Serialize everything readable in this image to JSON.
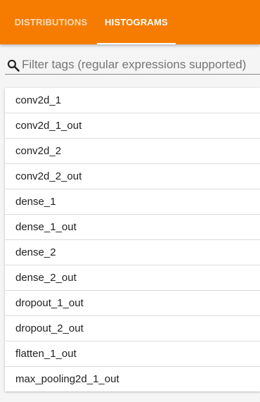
{
  "tabs": [
    {
      "label": "DISTRIBUTIONS",
      "active": false
    },
    {
      "label": "HISTOGRAMS",
      "active": true
    }
  ],
  "filter": {
    "placeholder": "Filter tags (regular expressions supported)",
    "value": "",
    "icon": "search-icon"
  },
  "tags": [
    "conv2d_1",
    "conv2d_1_out",
    "conv2d_2",
    "conv2d_2_out",
    "dense_1",
    "dense_1_out",
    "dense_2",
    "dense_2_out",
    "dropout_1_out",
    "dropout_2_out",
    "flatten_1_out",
    "max_pooling2d_1_out"
  ],
  "colors": {
    "header": "#f57c00",
    "active_tab": "#ffffff",
    "inactive_tab": "rgba(255,255,255,0.72)"
  }
}
